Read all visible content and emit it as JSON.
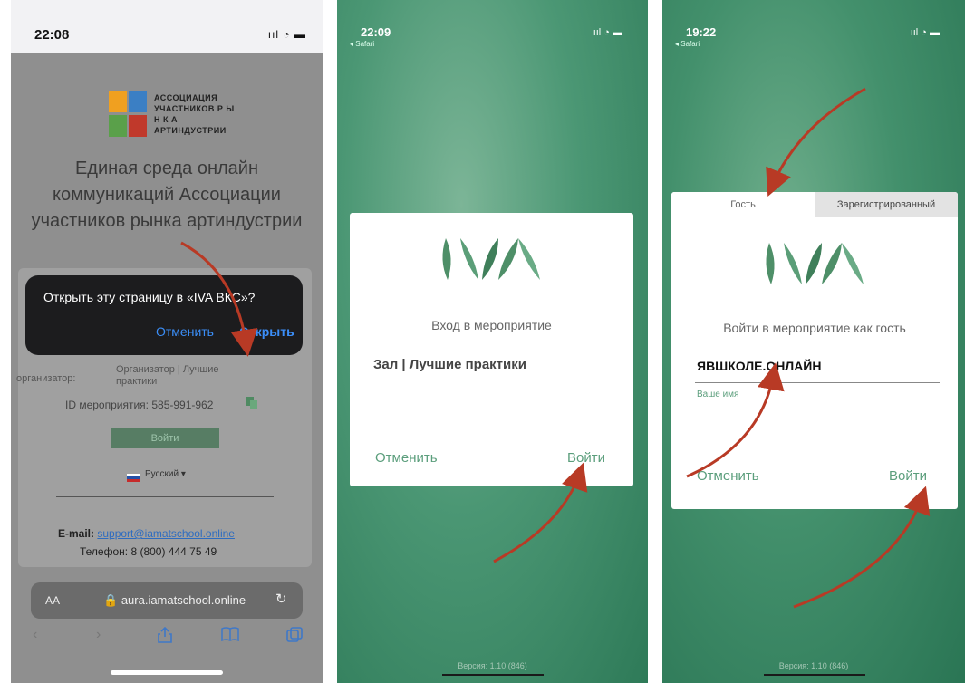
{
  "colors": {
    "arrow": "#b83a25",
    "iva_green": "#4e8f68",
    "link_blue": "#3b8ef8"
  },
  "screen1": {
    "status_time": "22:08",
    "status_icons": "signal-wifi-battery",
    "logo_text": "АССОЦИАЦИЯ УЧАСТНИКОВ Р Ы Н К А АРТИНДУСТРИИ",
    "title": "Единая среда онлайн коммуникаций Ассоциации участников рынка артиндустрии",
    "dialog": {
      "text": "Открыть эту страницу в «IVA ВКС»?",
      "cancel": "Отменить",
      "open": "Открыть"
    },
    "organizer_label": "организатор:",
    "organizer_value": "Организатор | Лучшие практики",
    "event_id": "ID мероприятия: 585-991-962",
    "login_button": "Войти",
    "language": "Русский ▾",
    "email_label": "E-mail:",
    "email": "support@iamatschool.online",
    "phone": "Телефон: 8 (800) 444 75 49",
    "url_aa": "AA",
    "url": "aura.iamatschool.online"
  },
  "screen2": {
    "status_time": "22:09",
    "back_app": "◂ Safari",
    "title": "Вход в мероприятие",
    "room": "Зал | Лучшие практики",
    "cancel": "Отменить",
    "login": "Войти",
    "version": "Версия: 1.10 (846)"
  },
  "screen3": {
    "status_time": "19:22",
    "back_app": "◂ Safari",
    "tab_guest": "Гость",
    "tab_registered": "Зарегистрированный",
    "title": "Войти в мероприятие как гость",
    "name_value": "ЯВШКОЛЕ.ОНЛАЙН",
    "name_hint": "Ваше имя",
    "cancel": "Отменить",
    "login": "Войти",
    "version": "Версия: 1.10 (846)"
  }
}
